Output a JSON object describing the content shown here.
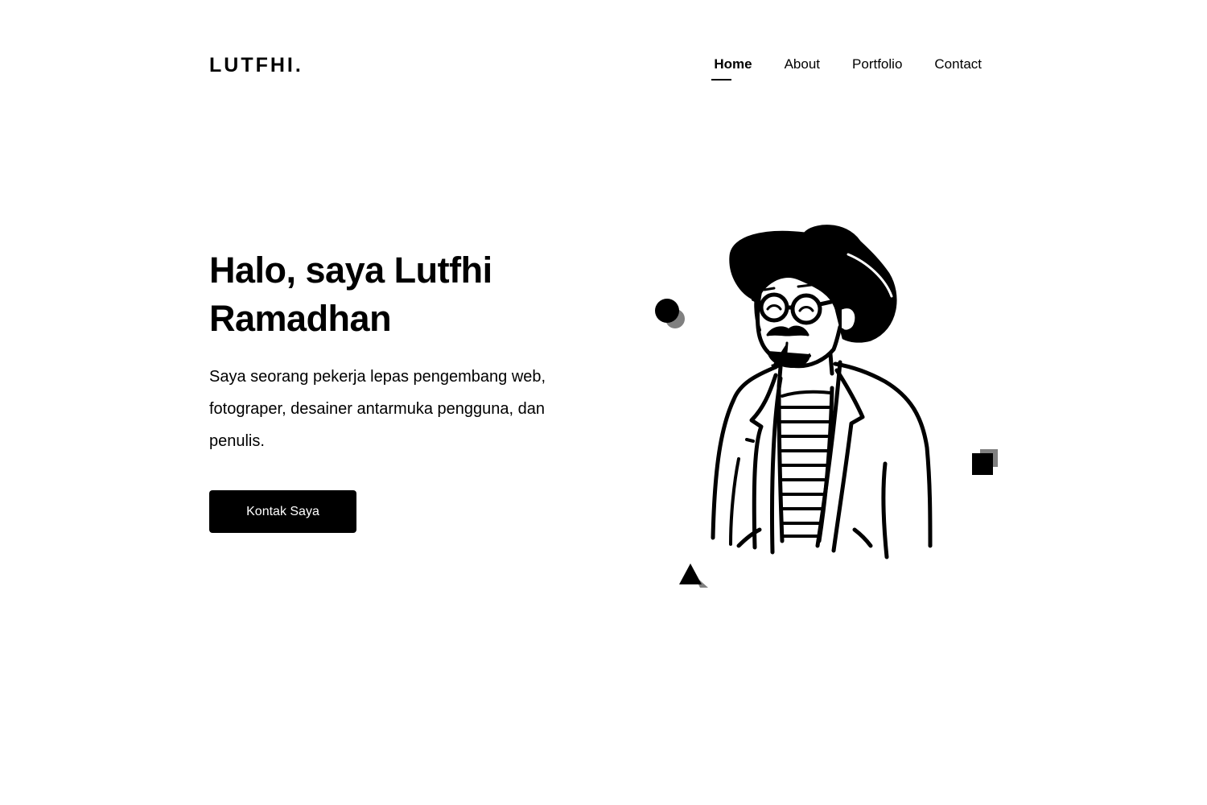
{
  "header": {
    "logo": "LUTFHI.",
    "nav": [
      {
        "label": "Home",
        "active": true
      },
      {
        "label": "About",
        "active": false
      },
      {
        "label": "Portfolio",
        "active": false
      },
      {
        "label": "Contact",
        "active": false
      }
    ]
  },
  "hero": {
    "title": "Halo, saya Lutfhi Ramadhan",
    "description": "Saya seorang pekerja lepas pengembang web, fotograper, desainer antarmuka pengguna, dan penulis.",
    "cta_label": "Kontak Saya"
  },
  "illustration": {
    "subject": "man-with-hat-illustration",
    "decorations": [
      "circle-shape",
      "square-shape",
      "triangle-shape"
    ]
  },
  "colors": {
    "background": "#ffffff",
    "primary": "#000000",
    "accent_gray": "#808080"
  }
}
